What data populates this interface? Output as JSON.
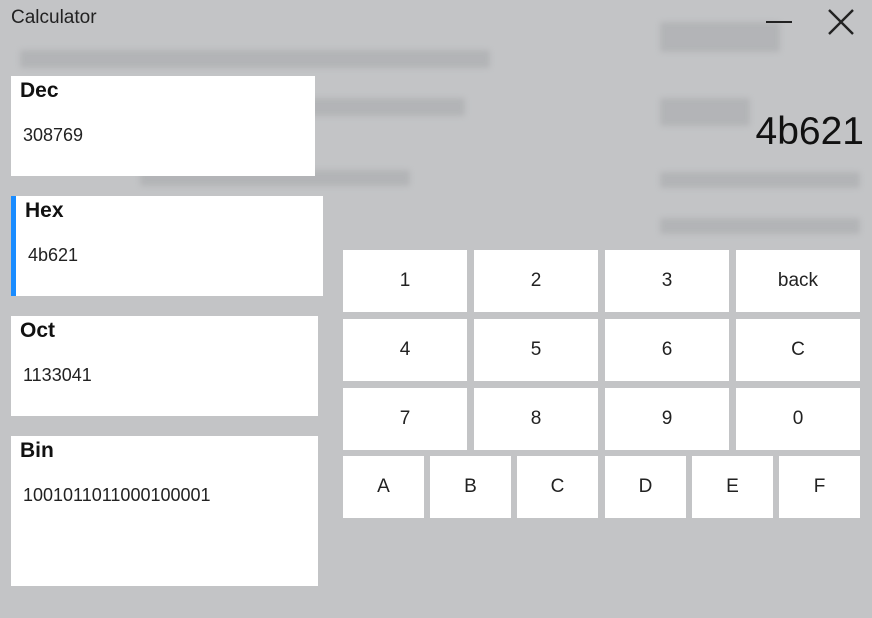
{
  "window": {
    "title": "Calculator",
    "minimize_icon": "minimize-icon",
    "close_icon": "close-icon"
  },
  "display": {
    "value": "4b621"
  },
  "bases": [
    {
      "label": "Dec",
      "value": "308769",
      "selected": false
    },
    {
      "label": "Hex",
      "value": "4b621",
      "selected": true
    },
    {
      "label": "Oct",
      "value": "1133041",
      "selected": false
    },
    {
      "label": "Bin",
      "value": "1001011011000100001",
      "selected": false
    }
  ],
  "keypad": {
    "rows": [
      [
        "1",
        "2",
        "3",
        "back"
      ],
      [
        "4",
        "5",
        "6",
        "C"
      ],
      [
        "7",
        "8",
        "9",
        "0"
      ]
    ],
    "hex_row": [
      "A",
      "B",
      "C",
      "D",
      "E",
      "F"
    ]
  },
  "colors": {
    "accent": "#1a8cff",
    "background": "#c3c4c6",
    "card": "#ffffff"
  }
}
